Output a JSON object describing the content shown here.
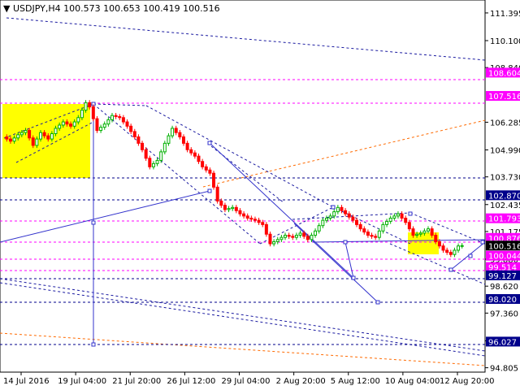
{
  "chart_data": {
    "type": "candlestick",
    "symbol": "USDJPY,H4",
    "ohlc": {
      "open": "100.573",
      "high": "100.653",
      "low": "100.419",
      "close": "100.516"
    },
    "ylim": [
      94.6,
      112.0
    ],
    "y_ticks": [
      "111.395",
      "110.100",
      "108.840",
      "106.285",
      "104.990",
      "103.730",
      "102.435",
      "101.175",
      "99.880",
      "98.620",
      "97.360",
      "96.065",
      "94.805"
    ],
    "x_ticks": [
      "14 Jul 2016",
      "19 Jul 04:00",
      "21 Jul 20:00",
      "26 Jul 12:00",
      "29 Jul 04:00",
      "2 Aug 20:00",
      "5 Aug 12:00",
      "10 Aug 04:00",
      "12 Aug 20:00"
    ],
    "price_labels": [
      {
        "value": "108.604",
        "color": "#ff00ff"
      },
      {
        "value": "107.516",
        "color": "#ff00ff"
      },
      {
        "value": "102.870",
        "color": "#00008b"
      },
      {
        "value": "101.793",
        "color": "#ff00ff"
      },
      {
        "value": "100.876",
        "color": "#ff00ff"
      },
      {
        "value": "100.516",
        "color": "#000000"
      },
      {
        "value": "100.044",
        "color": "#ff00ff"
      },
      {
        "value": "99.514",
        "color": "#ff00ff"
      },
      {
        "value": "99.127",
        "color": "#00008b"
      },
      {
        "value": "98.020",
        "color": "#00008b"
      },
      {
        "value": "96.027",
        "color": "#00008b"
      }
    ],
    "close_path": [
      [
        0,
        105.6
      ],
      [
        2,
        105.4
      ],
      [
        4,
        105.7
      ],
      [
        6,
        105.9
      ],
      [
        8,
        105.2
      ],
      [
        10,
        105.8
      ],
      [
        12,
        105.5
      ],
      [
        14,
        106.0
      ],
      [
        16,
        106.3
      ],
      [
        18,
        106.1
      ],
      [
        20,
        106.5
      ],
      [
        22,
        107.2
      ],
      [
        23,
        107.0
      ],
      [
        25,
        105.9
      ],
      [
        27,
        106.2
      ],
      [
        29,
        106.6
      ],
      [
        31,
        106.5
      ],
      [
        33,
        106.1
      ],
      [
        35,
        105.6
      ],
      [
        37,
        105.0
      ],
      [
        39,
        104.2
      ],
      [
        41,
        104.5
      ],
      [
        43,
        105.3
      ],
      [
        45,
        106.0
      ],
      [
        47,
        105.6
      ],
      [
        49,
        105.0
      ],
      [
        51,
        104.7
      ],
      [
        53,
        104.2
      ],
      [
        55,
        103.9
      ],
      [
        57,
        102.6
      ],
      [
        59,
        102.2
      ],
      [
        61,
        102.3
      ],
      [
        63,
        102.0
      ],
      [
        65,
        101.8
      ],
      [
        67,
        101.7
      ],
      [
        69,
        101.5
      ],
      [
        71,
        100.6
      ],
      [
        73,
        100.8
      ],
      [
        75,
        101.0
      ],
      [
        77,
        100.9
      ],
      [
        79,
        101.1
      ],
      [
        81,
        100.8
      ],
      [
        83,
        101.2
      ],
      [
        85,
        101.7
      ],
      [
        87,
        101.9
      ],
      [
        89,
        102.3
      ],
      [
        91,
        102.0
      ],
      [
        93,
        101.7
      ],
      [
        95,
        101.3
      ],
      [
        97,
        101.0
      ],
      [
        99,
        100.9
      ],
      [
        101,
        101.5
      ],
      [
        103,
        101.8
      ],
      [
        105,
        102.0
      ],
      [
        107,
        101.6
      ],
      [
        109,
        101.0
      ],
      [
        111,
        101.1
      ],
      [
        113,
        101.3
      ],
      [
        115,
        100.7
      ],
      [
        117,
        100.3
      ],
      [
        119,
        100.1
      ],
      [
        121,
        100.5
      ],
      [
        122,
        100.516
      ]
    ]
  },
  "colors": {
    "up": "#00b000",
    "down": "#ff0000",
    "highlight": "#ffff00",
    "level_magenta": "#ff00ff",
    "level_navy": "#00008b",
    "trend_navy": "#1a1aa0",
    "trend_orange": "#ff6a00",
    "line_blue": "#3333cc"
  }
}
